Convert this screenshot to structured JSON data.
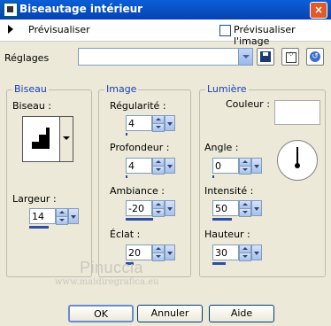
{
  "window": {
    "title": "Biseautage intérieur"
  },
  "preview": {
    "label": "Prévisualiser",
    "image_label": "Prévisualiser l'image",
    "image_checked": false
  },
  "settings": {
    "label": "Réglages",
    "value": ""
  },
  "groups": {
    "biseau": {
      "title": "Biseau",
      "bevel_label": "Biseau :",
      "width_label": "Largeur :",
      "width_value": "14",
      "width_fill": 0.5
    },
    "image": {
      "title": "Image",
      "smoothness_label": "Régularité :",
      "smoothness_value": "4",
      "smoothness_fill": 0.05,
      "depth_label": "Profondeur :",
      "depth_value": "4",
      "depth_fill": 0.05,
      "ambience_label": "Ambiance :",
      "ambience_value": "-20",
      "ambience_fill": 0.7,
      "shininess_label": "Éclat :",
      "shininess_value": "20",
      "shininess_fill": 0.2
    },
    "light": {
      "title": "Lumière",
      "color_label": "Couleur :",
      "color": "#ffffff",
      "angle_label": "Angle :",
      "angle_value": "0",
      "angle_fill": 0.02,
      "intensity_label": "Intensité :",
      "intensity_value": "50",
      "intensity_fill": 0.5,
      "elevation_label": "Hauteur :",
      "elevation_value": "30",
      "elevation_fill": 0.35
    }
  },
  "watermark": {
    "name": "Pinuccia",
    "url": "www.maidiregrafica.eu"
  },
  "buttons": {
    "ok": "OK",
    "cancel": "Annuler",
    "help": "Aide"
  },
  "colors": {
    "titlebar": "#0842b0",
    "legend": "#1a3fb4",
    "dialog_bg": "#ece9d8"
  }
}
